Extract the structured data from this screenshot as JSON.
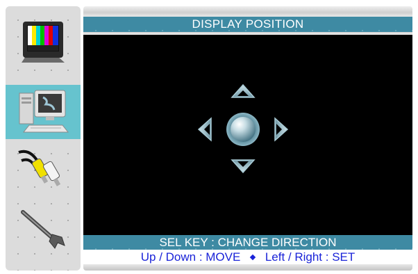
{
  "menu": {
    "title": "DISPLAY POSITION",
    "status": "SEL KEY : CHANGE DIRECTION",
    "help_move": "Up / Down : MOVE",
    "help_set": "Left / Right : SET"
  },
  "sidebar": {
    "items": [
      {
        "name": "picture",
        "icon": "tv-color-bars-icon",
        "selected": false
      },
      {
        "name": "pc",
        "icon": "computer-icon",
        "selected": true
      },
      {
        "name": "av-input",
        "icon": "rca-cable-icon",
        "selected": false
      },
      {
        "name": "setup",
        "icon": "wrench-icon",
        "selected": false
      }
    ]
  },
  "colors": {
    "accent": "#3e8aa3",
    "selected": "#66c3ce",
    "help_text": "#1a23d8",
    "screen": "#000000"
  },
  "dpad": {
    "icons": [
      "arrow-up-icon",
      "arrow-left-icon",
      "center-ball-icon",
      "arrow-right-icon",
      "arrow-down-icon"
    ]
  }
}
